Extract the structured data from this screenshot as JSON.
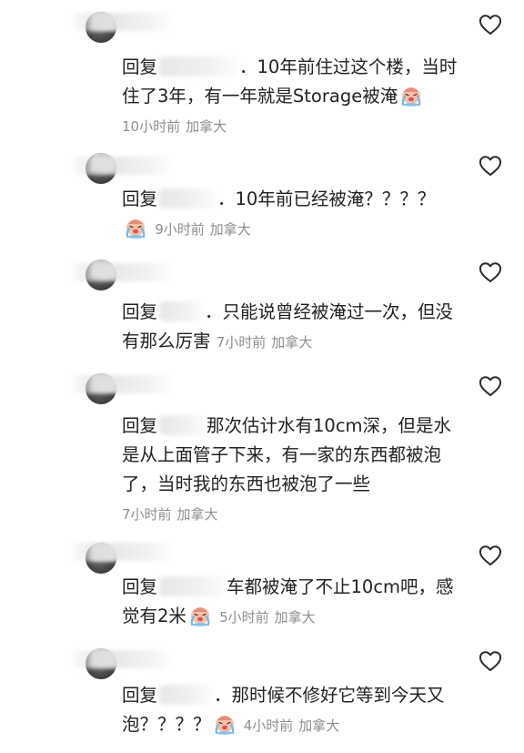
{
  "reply_prefix": "回复",
  "comments": [
    {
      "text_before": "．10年前住过这个楼，当时住了3年，有一年就是Storage被淹",
      "emoji": "crying-face-emoji",
      "time": "10小时前",
      "location": "加拿大"
    },
    {
      "text_before": "．10年前已经被淹？？？？",
      "emoji": "crying-face-emoji",
      "time": "9小时前",
      "location": "加拿大"
    },
    {
      "text_before": "．只能说曾经被淹过一次，但没有那么厉害",
      "time": "7小时前",
      "location": "加拿大"
    },
    {
      "text_before": "那次估计水有10cm深，但是水是从上面管子下来，有一家的东西都被泡了，当时我的东西也被泡了一些",
      "time": "7小时前",
      "location": "加拿大"
    },
    {
      "text_before": "车都被淹了不止10cm吧，感觉有2米",
      "emoji": "crying-face-emoji",
      "time": "5小时前",
      "location": "加拿大"
    },
    {
      "text_before": "．那时候不修好它等到今天又泡？？？？",
      "emoji": "crying-face-emoji",
      "time": "4小时前",
      "location": "加拿大"
    }
  ],
  "colors": {
    "text": "#222222",
    "meta": "#8e8e8e",
    "heart": "#2b2b2b"
  }
}
